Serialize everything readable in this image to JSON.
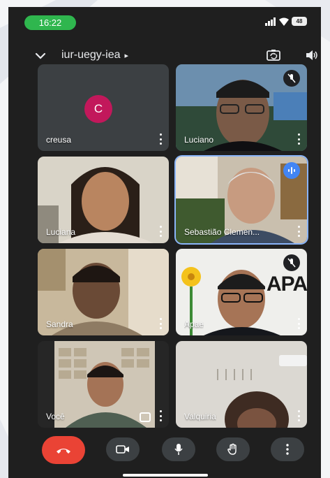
{
  "status_bar": {
    "time": "16:22",
    "battery": "48",
    "icons": [
      "signal-icon",
      "wifi-icon",
      "battery-icon"
    ]
  },
  "header": {
    "meeting_code": "iur-uegy-iea",
    "collapse_icon": "chevron-down-icon",
    "switch_camera_icon": "switch-camera-icon",
    "audio_icon": "speaker-icon"
  },
  "participants": [
    {
      "name": "creusa",
      "avatar_letter": "C",
      "avatar_color": "#c2185b",
      "mic_muted": false,
      "speaking": false
    },
    {
      "name": "Luciano",
      "mic_muted": true,
      "speaking": false
    },
    {
      "name": "Luciana",
      "mic_muted": false,
      "speaking": false
    },
    {
      "name": "Sebastião Clemen...",
      "mic_muted": false,
      "speaking": true
    },
    {
      "name": "Sandra",
      "mic_muted": false,
      "speaking": false
    },
    {
      "name": "Apae",
      "mic_muted": true,
      "speaking": false,
      "background_text": "APA"
    },
    {
      "name": "Você",
      "mic_muted": false,
      "speaking": false,
      "self": true
    },
    {
      "name": "Valquiria",
      "mic_muted": false,
      "speaking": false
    }
  ],
  "controls": [
    {
      "name": "end-call",
      "icon": "phone-hangup-icon",
      "color": "#ea4335"
    },
    {
      "name": "camera",
      "icon": "video-camera-icon"
    },
    {
      "name": "microphone",
      "icon": "microphone-icon"
    },
    {
      "name": "raise-hand",
      "icon": "hand-icon"
    },
    {
      "name": "more-options",
      "icon": "more-vertical-icon"
    }
  ],
  "colors": {
    "background": "#1f1f1f",
    "tile": "#3c4043",
    "status_green": "#2fb64e",
    "speaking_blue": "#4285f4",
    "end_call_red": "#ea4335"
  }
}
